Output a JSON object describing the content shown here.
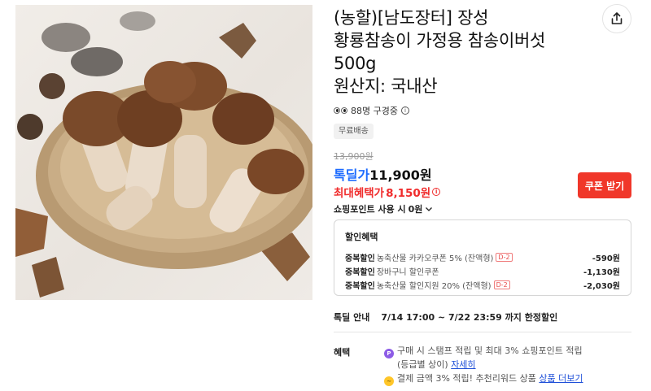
{
  "product": {
    "title_lines": [
      "(농할)[남도장터] 장성",
      "황룡참송이 가정용 참송이버섯",
      "500g",
      "원산지: 국내산"
    ],
    "viewers": "88명 구경중",
    "free_shipping": "무료배송",
    "original_price": "13,900원",
    "deal_label": "톡딜가",
    "deal_price": "11,900원",
    "max_benefit_label": "최대혜택가",
    "max_benefit_price": "8,150원",
    "coupon_button": "쿠폰 받기",
    "points_label": "쇼핑포인트 사용 시",
    "points_value": "0원"
  },
  "discounts": {
    "title": "할인혜택",
    "rows": [
      {
        "kind": "중복할인",
        "desc": "농축산물 카카오쿠폰 5% (잔액형)",
        "dday": "D-2",
        "value": "-590원"
      },
      {
        "kind": "중복할인",
        "desc": "장바구니 할인쿠폰",
        "dday": "",
        "value": "-1,130원"
      },
      {
        "kind": "중복할인",
        "desc": "농축산물 할인지원 20% (잔액형)",
        "dday": "D-2",
        "value": "-2,030원"
      }
    ]
  },
  "deal_info": {
    "label": "톡딜 안내",
    "value": "7/14 17:00 ~ 7/22 23:59 까지 한정할인"
  },
  "benefits": {
    "label": "혜택",
    "line1": "구매 시 스탬프 적립 및 최대 3% 쇼핑포인트 적립",
    "line1b": "(등급별 상이)",
    "line1_link": "자세히",
    "line2": "결제 금액 3% 적립! 추천리워드 상품",
    "line2_link": "상품 더보기"
  },
  "icons": {
    "share": "share-icon",
    "info": "info-icon",
    "chevron": "chevron-down-icon"
  },
  "colors": {
    "accent_blue": "#1e6cff",
    "accent_red": "#f02c2c",
    "coupon_bg": "#f0372a"
  }
}
